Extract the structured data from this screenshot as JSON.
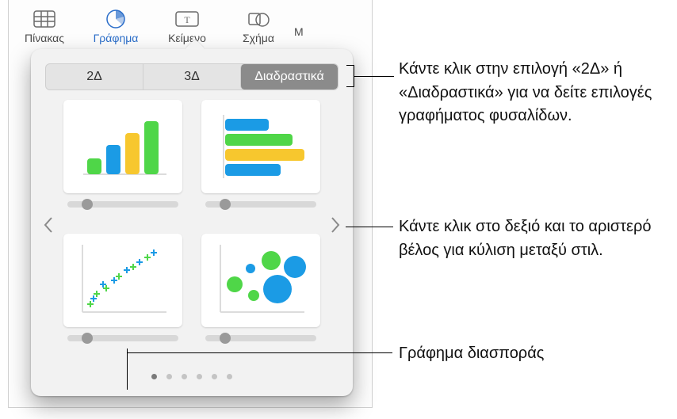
{
  "toolbar": {
    "items": [
      {
        "label": "Πίνακας"
      },
      {
        "label": "Γράφημα"
      },
      {
        "label": "Κείμενο"
      },
      {
        "label": "Σχήμα"
      }
    ],
    "partial": "Μ"
  },
  "popover": {
    "tabs": {
      "two_d": "2Δ",
      "three_d": "3Δ",
      "interactive": "Διαδραστικά"
    },
    "page_count": 6,
    "active_page": 0
  },
  "callouts": {
    "c1": "Κάντε κλικ στην επιλογή «2Δ» ή «Διαδραστικά» για να δείτε επιλογές γραφήματος φυσαλίδων.",
    "c2": "Κάντε κλικ στο δεξιό και το αριστερό βέλος για κύλιση μεταξύ στιλ.",
    "c3": "Γράφημα διασποράς"
  },
  "colors": {
    "green": "#4FD648",
    "blue": "#1B9BE5",
    "yellow": "#F7C72E",
    "grey": "#DADADA"
  }
}
